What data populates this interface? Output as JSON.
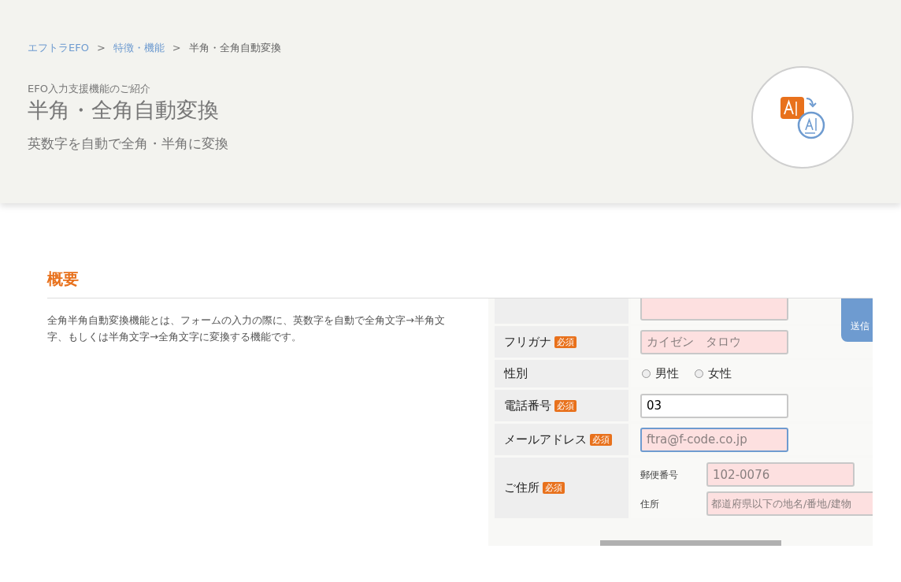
{
  "breadcrumb": [
    {
      "label": "エフトラEFO",
      "kind": "link"
    },
    {
      "label": "特徴・機能",
      "kind": "link"
    },
    {
      "label": "半角・全角自動変換",
      "kind": "current"
    }
  ],
  "breadcrumb_separators": [
    ">",
    ">"
  ],
  "header": {
    "eyebrow": "EFO入力支援機能のご紹介",
    "title": "半角・全角自動変換",
    "tagline": "英数字を自動で全角・半角に変換"
  },
  "section": {
    "heading": "概要",
    "description": "全角半角自動変換機能とは、フォームの入力の際に、英数字を自動で全角文字→半角文字、もしくは半角文字→全角文字に変換する機能です。"
  },
  "demo_form": {
    "tooltip": "送信",
    "rows": [
      {
        "kind": "text",
        "label": "フリガナ",
        "badge": "必須",
        "placeholder": "カイゼン　タロウ",
        "focused": false
      },
      {
        "kind": "radio",
        "label": "性別",
        "options": [
          {
            "label": "男性",
            "selected": false
          },
          {
            "label": "女性",
            "selected": false
          }
        ]
      },
      {
        "kind": "text",
        "label": "電話番号",
        "badge": "必須",
        "value": "03",
        "focused": false
      },
      {
        "kind": "text",
        "label": "メールアドレス",
        "badge": "必須",
        "placeholder": "ftra@f-code.co.jp",
        "focused": true
      },
      {
        "kind": "address",
        "label": "ご住所",
        "badge": "必須",
        "fields": [
          {
            "label": "郵便番号",
            "placeholder": "102-0076"
          },
          {
            "label": "住所",
            "placeholder": "都道府県以下の地名/番地/建物"
          }
        ]
      }
    ]
  }
}
